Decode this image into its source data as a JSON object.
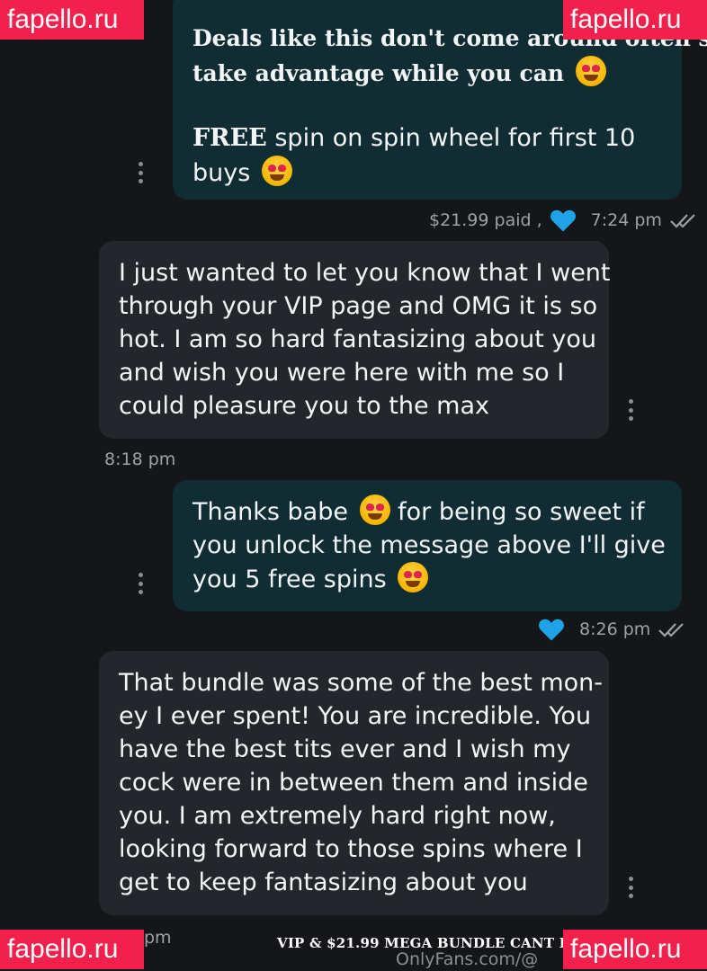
{
  "watermarks": {
    "brand": "fapello.ru"
  },
  "messages": [
    {
      "direction": "out",
      "line1": "Deals like this don't come around often so",
      "line2": "take advantage while you can",
      "promo_bold": "FREE",
      "promo_rest": " spin on spin wheel for first 10",
      "promo_line2": "buys",
      "price_label": "$21.99 paid ,",
      "time": "7:24 pm"
    },
    {
      "direction": "in",
      "lines": [
        "I just wanted to let you know that I went",
        "through your VIP page and OMG it is so",
        "hot. I am so hard fantasizing about you",
        "and wish you were here with me so I",
        "could pleasure you to the max"
      ],
      "time": "8:18 pm"
    },
    {
      "direction": "out",
      "line1a": "Thanks babe",
      "line1b": " for being so sweet if",
      "line2": "you unlock the message above I'll give",
      "line3": "you 5 free spins",
      "time": "8:26 pm"
    },
    {
      "direction": "in",
      "lines": [
        "That bundle was some of the best mon-",
        "ey I ever spent! You are incredible. You",
        "have the best tits ever and I wish my",
        "cock were in between them and inside",
        "you. I am extremely hard right now,",
        "looking forward to those spins where I",
        "get to keep fantasizing about you"
      ],
      "time_partial": "pm"
    }
  ],
  "footer": {
    "caption": "VIP & $21.99 MEGA BUNDLE CANT BE MISSED",
    "onlyfans": "OnlyFans.com/@"
  },
  "colors": {
    "background": "#151619",
    "outgoing_bubble": "#0f2d33",
    "incoming_bubble": "#23262b",
    "heart": "#1ea3e8",
    "watermark": "#f2204b"
  }
}
